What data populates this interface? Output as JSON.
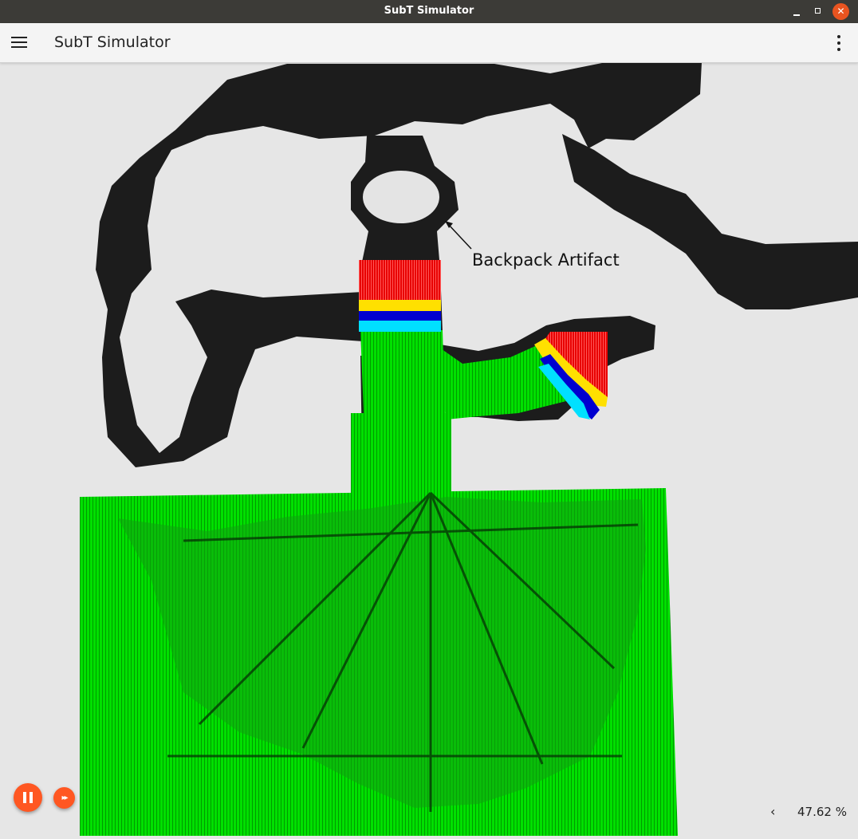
{
  "window": {
    "title": "SubT Simulator",
    "close_glyph": "✕"
  },
  "appbar": {
    "title": "SubT Simulator",
    "menu_icon": "hamburger-menu-icon",
    "overflow_icon": "vertical-dots-icon"
  },
  "scene": {
    "annotation": "Backpack Artifact"
  },
  "playback": {
    "pause_icon": "pause-icon",
    "step_icon": "fast-forward-icon",
    "step_glyph": "▸▸"
  },
  "stats": {
    "chevron": "‹",
    "real_time_factor": "47.62 %"
  },
  "colors": {
    "accent": "#ff5722",
    "titlebar": "#3c3b37",
    "close_button": "#e95420",
    "cave": "#1a1a1a",
    "lidar_green": "#00e000"
  }
}
